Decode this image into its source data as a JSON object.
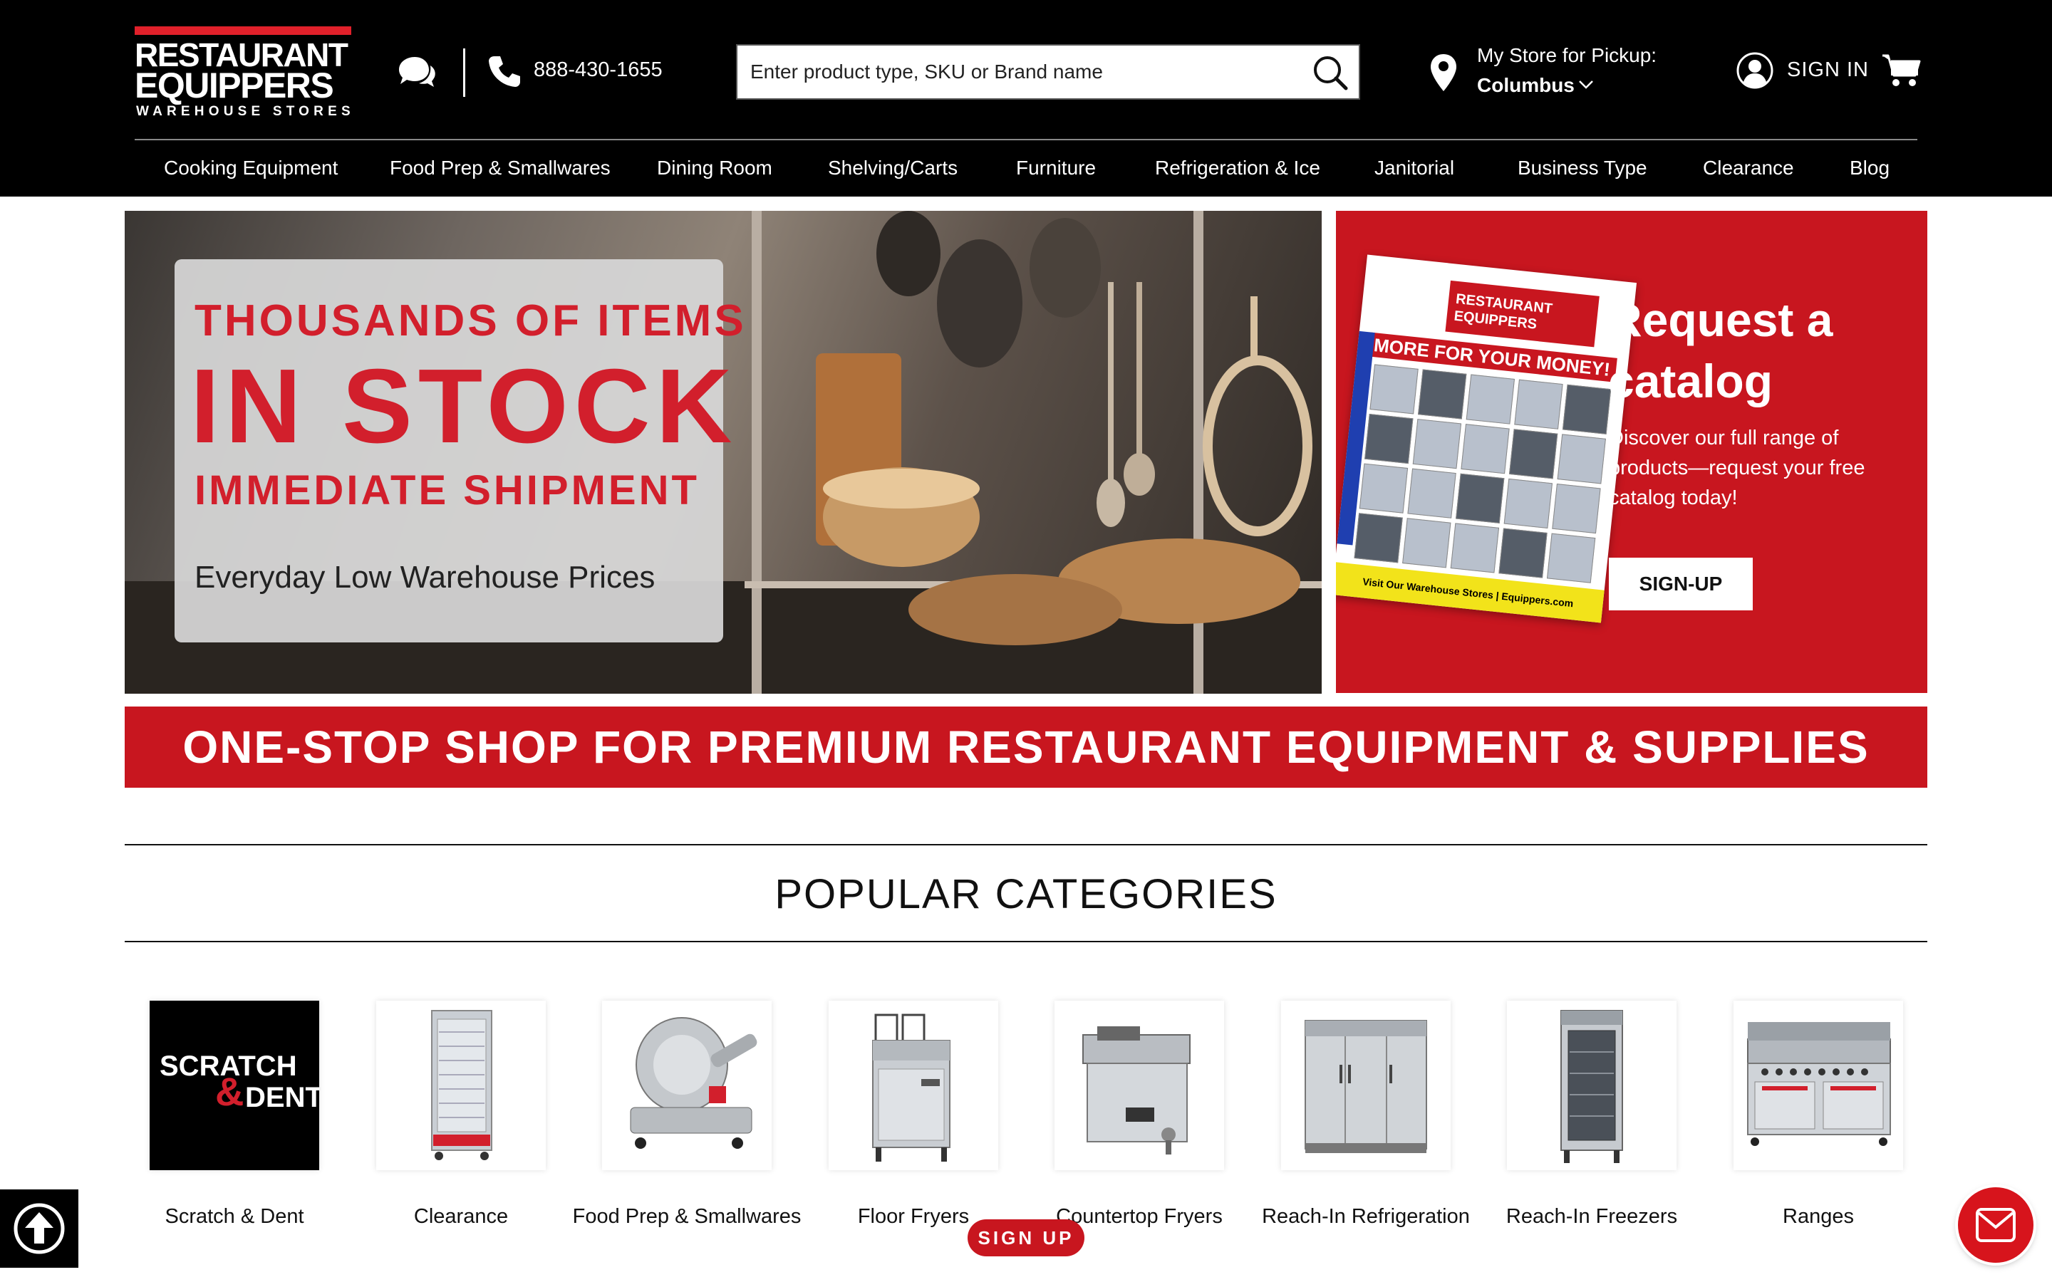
{
  "logo": {
    "line1": "RESTAURANT",
    "line2": "EQUIPPERS",
    "line3": "WAREHOUSE STORES"
  },
  "header": {
    "phone": "888-430-1655",
    "search_placeholder": "Enter product type, SKU or Brand name",
    "store_label": "My Store for Pickup:",
    "store_name": "Columbus",
    "sign_in": "SIGN IN"
  },
  "nav": {
    "items": [
      {
        "label": "Cooking Equipment"
      },
      {
        "label": "Food Prep & Smallwares"
      },
      {
        "label": "Dining Room"
      },
      {
        "label": "Shelving/Carts"
      },
      {
        "label": "Furniture"
      },
      {
        "label": "Refrigeration & Ice"
      },
      {
        "label": "Janitorial"
      },
      {
        "label": "Business Type"
      },
      {
        "label": "Clearance"
      },
      {
        "label": "Blog"
      }
    ]
  },
  "hero": {
    "line1": "THOUSANDS OF ITEMS",
    "line2": "IN STOCK",
    "line3": "IMMEDIATE SHIPMENT",
    "line4": "Everyday Low Warehouse Prices"
  },
  "promo": {
    "catalog_brand1": "RESTAURANT",
    "catalog_brand2": "EQUIPPERS",
    "catalog_banner": "MORE FOR YOUR MONEY!",
    "catalog_footer": "Visit Our Warehouse Stores | Equippers.com",
    "title": "Request a catalog",
    "body": "Discover our full range of products—request your free catalog today!",
    "button": "SIGN-UP"
  },
  "banner": {
    "text": "ONE-STOP SHOP FOR PREMIUM RESTAURANT EQUIPMENT & SUPPLIES"
  },
  "categories": {
    "title": "POPULAR CATEGORIES",
    "scratch_line1": "SCRATCH",
    "scratch_amp": "&",
    "scratch_line2": "DENT",
    "items": [
      {
        "label": "Scratch & Dent"
      },
      {
        "label": "Clearance"
      },
      {
        "label": "Food Prep & Smallwares"
      },
      {
        "label": "Floor Fryers"
      },
      {
        "label": "Countertop Fryers"
      },
      {
        "label": "Reach-In Refrigeration"
      },
      {
        "label": "Reach-In Freezers"
      },
      {
        "label": "Ranges"
      }
    ]
  },
  "floating": {
    "signup": "SIGN UP"
  },
  "colors": {
    "brand_red": "#c8161f",
    "header_bg": "#000000"
  }
}
